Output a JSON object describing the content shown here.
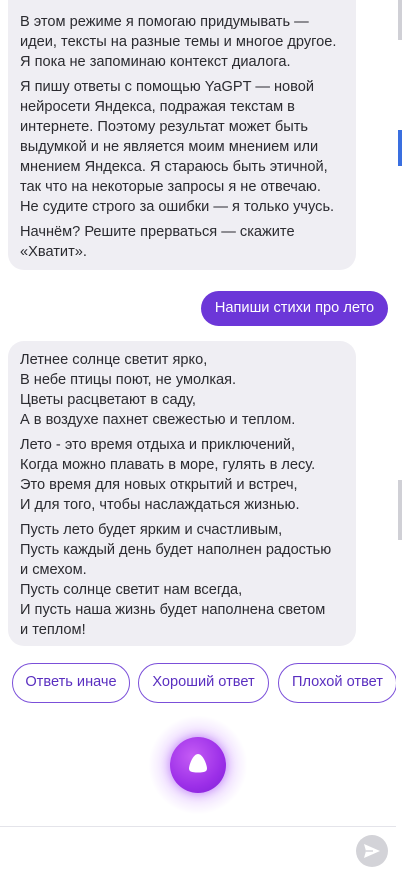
{
  "intro_message": {
    "paragraphs": [
      [
        "В этом режиме я помогаю придумывать —",
        "идеи, тексты на разные темы и многое другое.",
        "Я пока не запоминаю контекст диалога."
      ],
      [
        "Я пишу ответы с помощью YaGPT — новой",
        "нейросети Яндекса, подражая текстам в",
        "интернете. Поэтому результат может быть",
        "выдумкой и не является моим мнением или",
        "мнением Яндекса. Я стараюсь быть этичной,",
        "так что на некоторые запросы я не отвечаю.",
        "Не судите строго за ошибки — я только учусь."
      ],
      [
        "Начнём? Решите прерваться — скажите",
        "«Хватит»."
      ]
    ]
  },
  "user_message": {
    "text": "Напиши стихи про лето"
  },
  "poem_message": {
    "paragraphs": [
      [
        "Летнее солнце светит ярко,",
        "В небе птицы поют, не умолкая.",
        "Цветы расцветают в саду,",
        "А в воздухе пахнет свежестью и теплом."
      ],
      [
        "Лето - это время отдыха и приключений,",
        "Когда можно плавать в море, гулять в лесу.",
        "Это время для новых открытий и встреч,",
        "И для того, чтобы наслаждаться жизнью."
      ],
      [
        "Пусть лето будет ярким и счастливым,",
        "Пусть каждый день будет наполнен радостью",
        "и смехом.",
        "Пусть солнце светит нам всегда,",
        "И пусть наша жизнь будет наполнена светом",
        "и теплом!"
      ]
    ]
  },
  "suggestions": [
    "Ответь иначе",
    "Хороший ответ",
    "Плохой ответ"
  ],
  "icons": {
    "assistant": "alice-icon",
    "send": "send-arrow-icon"
  },
  "colors": {
    "accent": "#6c37d8",
    "bubble": "#efeef3",
    "chip_border": "#7b4fd9"
  }
}
